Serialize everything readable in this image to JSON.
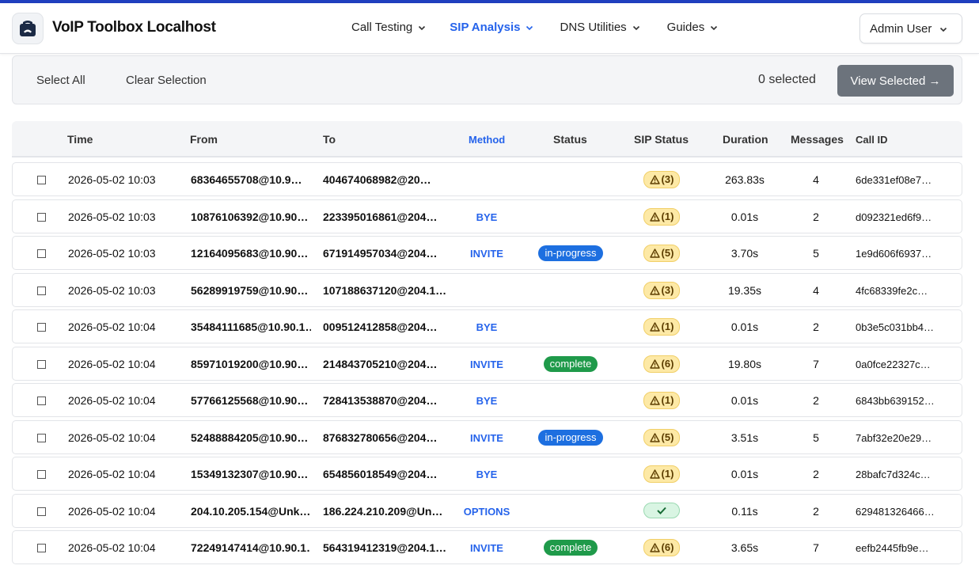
{
  "app": {
    "title": "VoIP Toolbox Localhost"
  },
  "nav": [
    {
      "label": "Call Testing",
      "active": false
    },
    {
      "label": "SIP Analysis",
      "active": true
    },
    {
      "label": "DNS Utilities",
      "active": false
    },
    {
      "label": "Guides",
      "active": false
    }
  ],
  "user": {
    "label": "Admin User"
  },
  "toolbar": {
    "select_all": "Select All",
    "clear_selection": "Clear Selection",
    "selected_count": "0 selected",
    "view_selected": "View Selected →"
  },
  "table": {
    "headers": {
      "time": "Time",
      "from": "From",
      "to": "To",
      "method": "Method",
      "status": "Status",
      "sip_status": "SIP Status",
      "duration": "Duration",
      "messages": "Messages",
      "call_id": "Call ID"
    },
    "rows": [
      {
        "time": "2026-05-02 10:03",
        "from": "68364655708@10.9…",
        "to": "404674068982@20…",
        "method": "",
        "status": "",
        "status_color": "",
        "sip": "(3)",
        "sip_ok": false,
        "duration": "263.83s",
        "messages": "4",
        "call_id": "6de331ef08e7…"
      },
      {
        "time": "2026-05-02 10:03",
        "from": "10876106392@10.90…",
        "to": "223395016861@204…",
        "method": "BYE",
        "status": "",
        "status_color": "",
        "sip": "(1)",
        "sip_ok": false,
        "duration": "0.01s",
        "messages": "2",
        "call_id": "d092321ed6f9…"
      },
      {
        "time": "2026-05-02 10:03",
        "from": "12164095683@10.90…",
        "to": "671914957034@204…",
        "method": "INVITE",
        "status": "in-progress",
        "status_color": "blue",
        "sip": "(5)",
        "sip_ok": false,
        "duration": "3.70s",
        "messages": "5",
        "call_id": "1e9d606f6937…"
      },
      {
        "time": "2026-05-02 10:03",
        "from": "56289919759@10.90…",
        "to": "107188637120@204.1…",
        "method": "",
        "status": "",
        "status_color": "",
        "sip": "(3)",
        "sip_ok": false,
        "duration": "19.35s",
        "messages": "4",
        "call_id": "4fc68339fe2c…"
      },
      {
        "time": "2026-05-02 10:04",
        "from": "35484111685@10.90.1…",
        "to": "009512412858@204…",
        "method": "BYE",
        "status": "",
        "status_color": "",
        "sip": "(1)",
        "sip_ok": false,
        "duration": "0.01s",
        "messages": "2",
        "call_id": "0b3e5c031bb4…"
      },
      {
        "time": "2026-05-02 10:04",
        "from": "85971019200@10.90…",
        "to": "214843705210@204…",
        "method": "INVITE",
        "status": "complete",
        "status_color": "green",
        "sip": "(6)",
        "sip_ok": false,
        "duration": "19.80s",
        "messages": "7",
        "call_id": "0a0fce22327c…"
      },
      {
        "time": "2026-05-02 10:04",
        "from": "57766125568@10.90…",
        "to": "728413538870@204…",
        "method": "BYE",
        "status": "",
        "status_color": "",
        "sip": "(1)",
        "sip_ok": false,
        "duration": "0.01s",
        "messages": "2",
        "call_id": "6843bb639152…"
      },
      {
        "time": "2026-05-02 10:04",
        "from": "52488884205@10.90…",
        "to": "876832780656@204…",
        "method": "INVITE",
        "status": "in-progress",
        "status_color": "blue",
        "sip": "(5)",
        "sip_ok": false,
        "duration": "3.51s",
        "messages": "5",
        "call_id": "7abf32e20e29…"
      },
      {
        "time": "2026-05-02 10:04",
        "from": "15349132307@10.90…",
        "to": "654856018549@204…",
        "method": "BYE",
        "status": "",
        "status_color": "",
        "sip": "(1)",
        "sip_ok": false,
        "duration": "0.01s",
        "messages": "2",
        "call_id": "28bafc7d324c…"
      },
      {
        "time": "2026-05-02 10:04",
        "from": "204.10.205.154@Unk…",
        "to": "186.224.210.209@Un…",
        "method": "OPTIONS",
        "status": "",
        "status_color": "",
        "sip": "",
        "sip_ok": true,
        "duration": "0.11s",
        "messages": "2",
        "call_id": "629481326466…"
      },
      {
        "time": "2026-05-02 10:04",
        "from": "72249147414@10.90.1…",
        "to": "564319412319@204.1…",
        "method": "INVITE",
        "status": "complete",
        "status_color": "green",
        "sip": "(6)",
        "sip_ok": false,
        "duration": "3.65s",
        "messages": "7",
        "call_id": "eefb2445fb9e…"
      }
    ]
  },
  "icons": {
    "logo": "phone-icon",
    "chevron": "chevron-down-icon",
    "warning": "warning-triangle-icon",
    "check": "check-icon"
  },
  "colors": {
    "accent": "#2563eb",
    "in_progress": "#1d6fe0",
    "complete": "#1f9a4a",
    "warning_bg": "#fde9a6",
    "ok_bg": "#d9f5e3"
  }
}
